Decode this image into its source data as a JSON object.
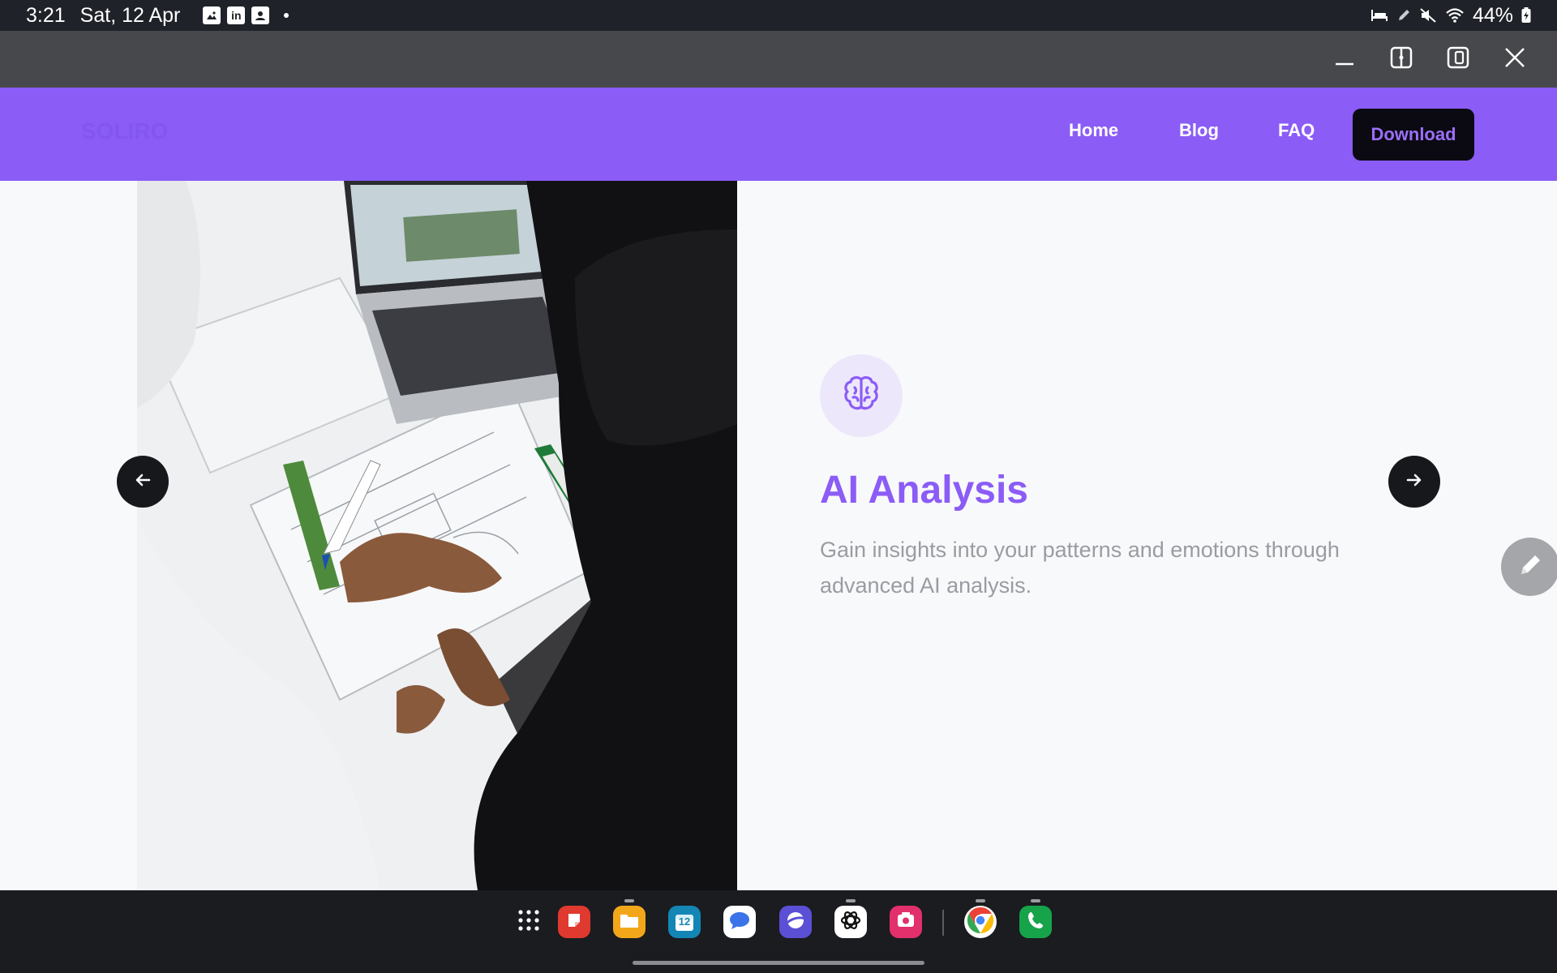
{
  "status_bar": {
    "time": "3:21",
    "date": "Sat, 12 Apr",
    "notification_icons": [
      "image-icon",
      "linkedin-icon",
      "contacts-icon"
    ],
    "linkedin_text": "in",
    "battery": "44%"
  },
  "window_controls": [
    "minimize-icon",
    "split-view-icon",
    "pop-up-view-icon",
    "close-icon"
  ],
  "nav": {
    "logo": "SOLIRO",
    "links": [
      "Home",
      "Blog",
      "FAQ"
    ],
    "download_label": "Download"
  },
  "feature": {
    "icon": "brain-icon",
    "title": "AI Analysis",
    "description": "Gain insights into your patterns and emotions through advanced AI analysis."
  },
  "dock": {
    "apps": [
      "apps-grid-icon",
      "samsung-notes-icon",
      "my-files-icon",
      "calendar-icon",
      "messages-icon",
      "samsung-internet-icon",
      "chatgpt-icon",
      "screen-recorder-icon",
      "chrome-icon",
      "phone-icon"
    ],
    "calendar_day": "12"
  },
  "colors": {
    "brand_purple": "#8b5cf6",
    "dark_button": "#0b0a12",
    "status_bar": "#1f2228",
    "caption_bar": "#47484b"
  }
}
